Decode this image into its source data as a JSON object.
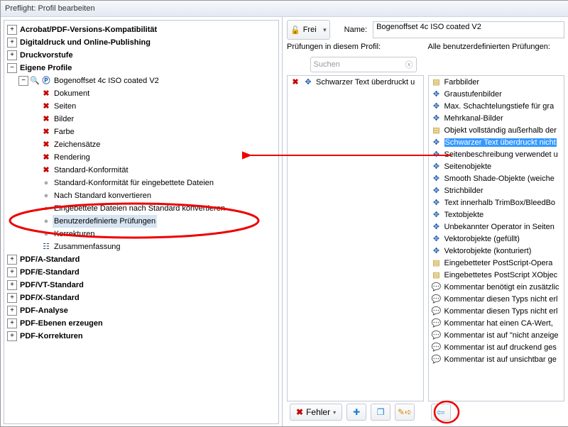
{
  "window": {
    "title": "Preflight: Profil bearbeiten"
  },
  "tree": [
    "Acrobat/PDF-Versions-Kompatibilität",
    "Digitaldruck und Online-Publishing",
    "Druckvorstufe",
    "Eigene Profile",
    "PDF/A-Standard",
    "PDF/E-Standard",
    "PDF/VT-Standard",
    "PDF/X-Standard",
    "PDF-Analyse",
    "PDF-Ebenen erzeugen",
    "PDF-Korrekturen"
  ],
  "profile": {
    "name": "Bogenoffset 4c ISO coated V2",
    "items": [
      "Dokument",
      "Seiten",
      "Bilder",
      "Farbe",
      "Zeichensätze",
      "Rendering",
      "Standard-Konformität",
      "Standard-Konformität für eingebettete Dateien",
      "Nach Standard konvertieren",
      "Eingebettete Dateien nach Standard konvertieren",
      "Benutzerdefinierte Prüfungen",
      "Korrekturen",
      "Zusammenfassung"
    ]
  },
  "header": {
    "lock": "Frei",
    "nameLabel": "Name:",
    "nameValue": "Bogenoffset 4c ISO coated V2"
  },
  "cols": {
    "left": {
      "title": "Prüfungen in diesem Profil:",
      "search": "Suchen",
      "items": [
        "Schwarzer Text überdruckt u"
      ]
    },
    "right": {
      "title": "Alle benutzerdefinierten Prüfungen:",
      "items": [
        {
          "ic": "pg",
          "t": "Farbbilder"
        },
        {
          "ic": "mv",
          "t": "Graustufenbilder"
        },
        {
          "ic": "mv",
          "t": "Max. Schachtelungstiefe für gra"
        },
        {
          "ic": "mv",
          "t": "Mehrkanal-Bilder"
        },
        {
          "ic": "pg",
          "t": "Objekt vollständig außerhalb der"
        },
        {
          "ic": "mv",
          "t": "Schwarzer Text überdruckt nicht",
          "hi": true
        },
        {
          "ic": "mv",
          "t": "Seitenbeschreibung verwendet u"
        },
        {
          "ic": "mv",
          "t": "Seitenobjekte"
        },
        {
          "ic": "mv",
          "t": "Smooth Shade-Objekte (weiche "
        },
        {
          "ic": "mv",
          "t": "Strichbilder"
        },
        {
          "ic": "mv",
          "t": "Text innerhalb TrimBox/BleedBo"
        },
        {
          "ic": "mv",
          "t": "Textobjekte"
        },
        {
          "ic": "mv",
          "t": "Unbekannter Operator in Seiten"
        },
        {
          "ic": "mv",
          "t": "Vektorobjekte (gefüllt)"
        },
        {
          "ic": "mv",
          "t": "Vektorobjekte (konturiert)"
        },
        {
          "ic": "pg",
          "t": "Eingebetteter PostScript-Opera"
        },
        {
          "ic": "pg",
          "t": "Eingebettetes PostScript XObjec"
        },
        {
          "ic": "sp",
          "t": "Kommentar benötigt ein zusätzlic"
        },
        {
          "ic": "sp",
          "t": "Kommentar diesen Typs nicht erl"
        },
        {
          "ic": "sp",
          "t": "Kommentar diesen Typs nicht erl"
        },
        {
          "ic": "sp",
          "t": "Kommentar hat einen CA-Wert, "
        },
        {
          "ic": "sp",
          "t": "Kommentar ist auf \"nicht anzeige"
        },
        {
          "ic": "sp",
          "t": "Kommentar ist auf druckend ges"
        },
        {
          "ic": "sp",
          "t": "Kommentar ist auf unsichtbar ge"
        }
      ]
    }
  },
  "buttons": {
    "errors": "Fehler"
  }
}
